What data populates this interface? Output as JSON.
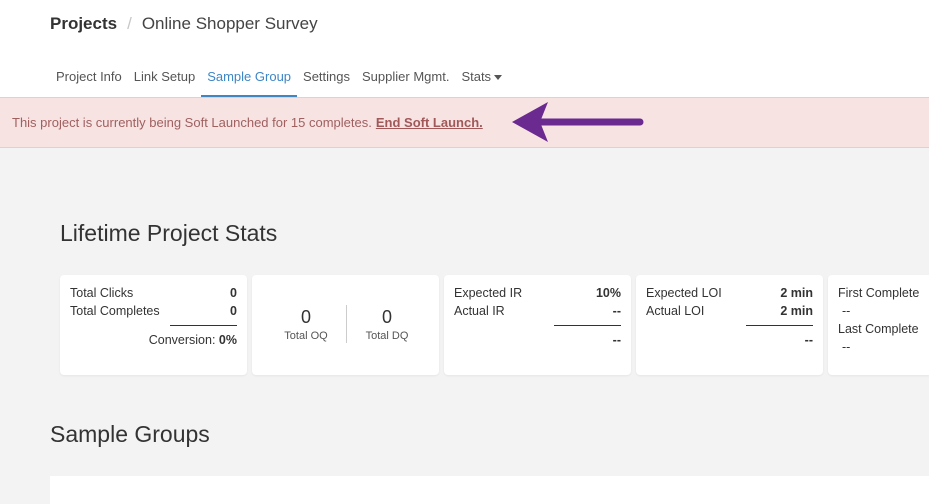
{
  "breadcrumb": {
    "root": "Projects",
    "separator": "/",
    "current": "Online Shopper Survey"
  },
  "tabs": [
    {
      "label": "Project Info"
    },
    {
      "label": "Link Setup"
    },
    {
      "label": "Sample Group",
      "active": true
    },
    {
      "label": "Settings"
    },
    {
      "label": "Supplier Mgmt."
    },
    {
      "label": "Stats"
    }
  ],
  "alert": {
    "text": "This project is currently being Soft Launched for 15 completes.",
    "link": "End Soft Launch."
  },
  "lifetime_stats": {
    "title": "Lifetime Project Stats",
    "clicks_card": {
      "total_clicks_label": "Total Clicks",
      "total_clicks": "0",
      "total_completes_label": "Total Completes",
      "total_completes": "0",
      "conversion_label": "Conversion:",
      "conversion": "0%"
    },
    "oq_card": {
      "total_oq": "0",
      "total_oq_label": "Total OQ",
      "total_dq": "0",
      "total_dq_label": "Total DQ"
    },
    "ir_card": {
      "expected_ir_label": "Expected IR",
      "expected_ir": "10%",
      "actual_ir_label": "Actual IR",
      "actual_ir": "--",
      "diff": "--"
    },
    "loi_card": {
      "expected_loi_label": "Expected LOI",
      "expected_loi": "2 min",
      "actual_loi_label": "Actual LOI",
      "actual_loi": "2 min",
      "diff": "--"
    },
    "complete_card": {
      "first_label": "First Complete",
      "first": "--",
      "last_label": "Last Complete",
      "last": "--"
    }
  },
  "sample_groups": {
    "title": "Sample Groups"
  },
  "colors": {
    "accent": "#3e86c6",
    "alert_bg": "#f8e3e3",
    "alert_text": "#a06060",
    "arrow": "#6a2a90"
  }
}
